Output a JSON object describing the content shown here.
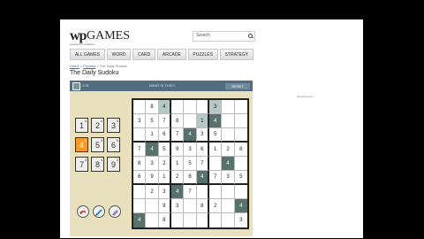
{
  "site": {
    "logo_wp": "wp",
    "logo_games": "GAMES",
    "tagline": "powered by arkadium",
    "search_placeholder": "Search",
    "nav": [
      "ALL GAMES",
      "WORD",
      "CARD",
      "ARCADE",
      "PUZZLES",
      "STRATEGY"
    ],
    "breadcrumb": [
      "Home",
      "Puzzles",
      "The Daily Sudoku"
    ],
    "page_title": "The Daily Sudoku",
    "ad_label": "advertisement"
  },
  "game": {
    "timer": "2:31",
    "hint": "WHAT IS THIS?",
    "reset_label": "RESET",
    "keys": [
      {
        "n": "1",
        "c": "4"
      },
      {
        "n": "2",
        "c": "4"
      },
      {
        "n": "3",
        "c": "3"
      },
      {
        "n": "4",
        "c": "4"
      },
      {
        "n": "5",
        "c": "3"
      },
      {
        "n": "6",
        "c": "6"
      },
      {
        "n": "7",
        "c": "3"
      },
      {
        "n": "8",
        "c": "4"
      },
      {
        "n": "9",
        "c": "3"
      }
    ],
    "selected_key": 4,
    "tools": [
      "undo-icon",
      "pencil-icon",
      "eraser-icon"
    ],
    "colors": {
      "accent": "#f49a2d",
      "board_bg": "#e9e1bd",
      "bar": "#526d80",
      "highlight": "#b4c9c6",
      "dark_cell": "#57726a"
    },
    "grid": [
      [
        "",
        "8",
        "4",
        "",
        "",
        "",
        "3",
        "",
        ""
      ],
      [
        "3",
        "5",
        "7",
        "8",
        "",
        "1",
        "4",
        "",
        ""
      ],
      [
        "",
        "1",
        "6",
        "7",
        "4",
        "3",
        "5",
        "",
        ""
      ],
      [
        "7",
        "4",
        "5",
        "9",
        "3",
        "6",
        "1",
        "2",
        "8"
      ],
      [
        "8",
        "3",
        "2",
        "1",
        "5",
        "7",
        "",
        "4",
        ""
      ],
      [
        "6",
        "9",
        "1",
        "2",
        "8",
        "4",
        "7",
        "3",
        "5"
      ],
      [
        "",
        "2",
        "3",
        "4",
        "7",
        "",
        "",
        "",
        ""
      ],
      [
        "",
        "",
        "9",
        "3",
        "",
        "8",
        "2",
        "",
        "4"
      ],
      [
        "4",
        "",
        "8",
        "",
        "",
        "",
        "",
        "",
        "3"
      ]
    ],
    "shade": [
      [
        "",
        "",
        "g",
        "",
        "",
        "",
        "g",
        "",
        ""
      ],
      [
        "",
        "",
        "",
        "",
        "",
        "g",
        "d",
        "",
        ""
      ],
      [
        "",
        "",
        "",
        "",
        "d",
        "",
        "",
        "",
        ""
      ],
      [
        "",
        "d",
        "",
        "",
        "",
        "",
        "",
        "",
        ""
      ],
      [
        "",
        "",
        "",
        "",
        "",
        "",
        "",
        "d",
        ""
      ],
      [
        "",
        "",
        "",
        "",
        "",
        "d",
        "",
        "",
        ""
      ],
      [
        "",
        "",
        "",
        "d",
        "",
        "",
        "",
        "",
        ""
      ],
      [
        "",
        "",
        "",
        "",
        "",
        "",
        "",
        "",
        "d"
      ],
      [
        "d",
        "",
        "",
        "",
        "",
        "",
        "",
        "",
        ""
      ]
    ]
  }
}
